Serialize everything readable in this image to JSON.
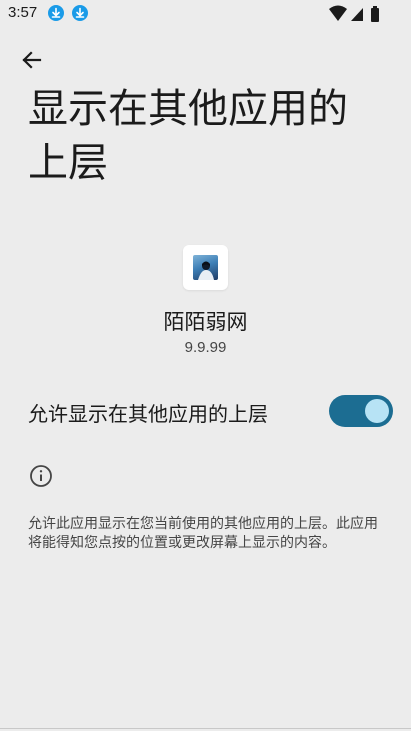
{
  "status_bar": {
    "time": "3:57",
    "icons": [
      "download-icon",
      "download-icon",
      "wifi-icon",
      "signal-icon",
      "battery-icon"
    ]
  },
  "nav": {
    "back_icon": "arrow-back-icon"
  },
  "page": {
    "title": "显示在其他应用的上层"
  },
  "app": {
    "name": "陌陌弱网",
    "version": "9.9.99"
  },
  "permission": {
    "label": "允许显示在其他应用的上层",
    "enabled": true
  },
  "info": {
    "icon": "info-icon",
    "text": "允许此应用显示在您当前使用的其他应用的上层。此应用将能得知您点按的位置或更改屏幕上显示的内容。"
  },
  "colors": {
    "background": "#ececec",
    "accent": "#1c6d92",
    "toggle_thumb": "#b7e3f5",
    "download_badge": "#1a9be8"
  }
}
